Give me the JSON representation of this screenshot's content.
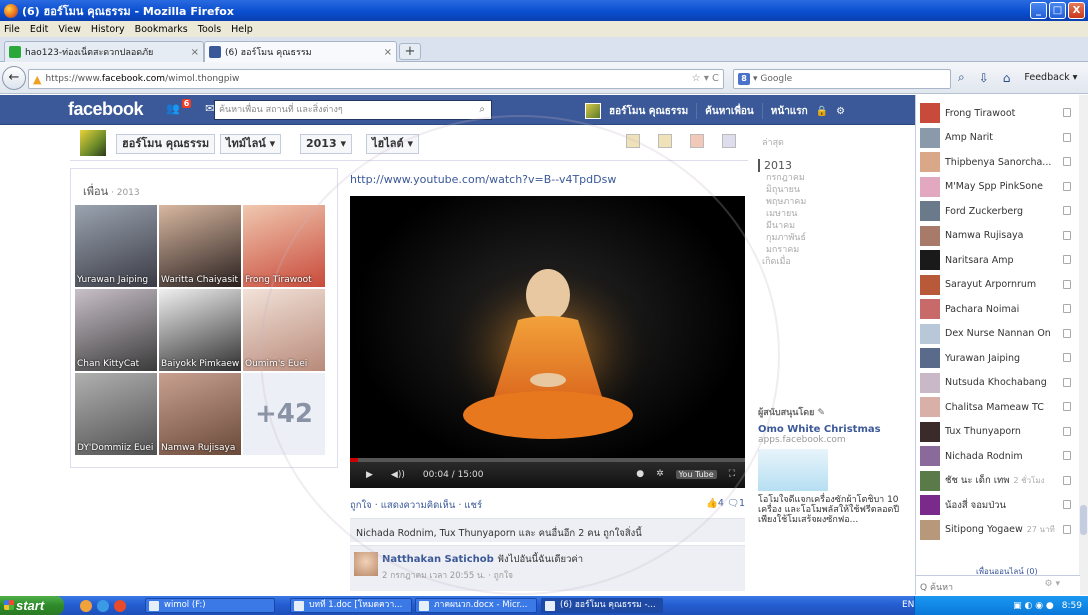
{
  "window": {
    "title": "(6) ฮอร์โมน คุณธรรม - Mozilla Firefox",
    "min": "_",
    "max": "□",
    "close": "X"
  },
  "menu": [
    "File",
    "Edit",
    "View",
    "History",
    "Bookmarks",
    "Tools",
    "Help"
  ],
  "tabs": [
    {
      "label": "hao123-ท่องเน็ตสะดวกปลอดภัย",
      "close": "×",
      "active": false
    },
    {
      "label": "(6) ฮอร์โมน คุณธรรม",
      "close": "×",
      "active": true
    }
  ],
  "newtab": "+",
  "nav": {
    "back": "←",
    "url_prefix": "https://www.",
    "url_domain": "facebook.com",
    "url_path": "/wimol.thongpiw",
    "url_right": "☆ ▾ C",
    "search_engine": "8",
    "search_placeholder": "▾ Google",
    "search_icon": "⌕",
    "download_icon": "⇩",
    "home_icon": "⌂",
    "feedback": "Feedback ▾"
  },
  "fb": {
    "logo": "facebook",
    "notif_badge": "6",
    "search_placeholder": "ค้นหาเพื่อน สถานที่ และสิ่งต่างๆ",
    "search_icon": "⌕",
    "user": "ฮอร์โมน คุณธรรม",
    "find_friends": "ค้นหาเพื่อน",
    "home": "หน้าแรก",
    "menu_icon": "⚙"
  },
  "profile": {
    "name": "ฮอร์โมน คุณธรรม",
    "timeline": "ไทม์ไลน์ ▾",
    "year": "2013 ▾",
    "highlights": "ไฮไลต์ ▾"
  },
  "friends": {
    "title": "เพื่อน",
    "year": " · 2013",
    "more": "+42",
    "list": [
      {
        "name": "Yurawan Jaiping",
        "color1": "#9aa4b0",
        "color2": "#3a3a44"
      },
      {
        "name": "Waritta Chaiyasit",
        "color1": "#d8b8a0",
        "color2": "#2a2020"
      },
      {
        "name": "Frong Tirawoot",
        "color1": "#f0c8b0",
        "color2": "#c84a3a"
      },
      {
        "name": "Chan KittyCat",
        "color1": "#c8c0c8",
        "color2": "#3a3a3a"
      },
      {
        "name": "Baiyokk Pimkaew",
        "color1": "#f0f0f0",
        "color2": "#303030"
      },
      {
        "name": "Oumim's Euei",
        "color1": "#f2e2d8",
        "color2": "#b88a7a"
      },
      {
        "name": "DY'Dommiiz Euei",
        "color1": "#b0b0b0",
        "color2": "#505050"
      },
      {
        "name": "Namwa Rujisaya",
        "color1": "#c8a090",
        "color2": "#6a4a3a"
      }
    ]
  },
  "post": {
    "link": "http://www.youtube.com/watch?v=B--v4TpdDsw",
    "time": "00:04 / 15:00",
    "progress": 0.02,
    "play": "▶",
    "volume": "◀))",
    "yt": "You Tube",
    "actions": "ถูกใจ · แสดงความคิดเห็น · แชร์",
    "counts": "👍4 🗨1",
    "likers": "Nichada Rodnim, Tux Thunyaporn และ คนอื่นอีก 2 คน ถูกใจสิ่งนี้",
    "comment_name": "Natthakan Satichob",
    "comment_text": "ฟังไปอันนี้ฉันเดียวค่า",
    "comment_meta": "2 กรกฎาคม เวลา 20:55 น. · ถูกใจ"
  },
  "timeline": {
    "recent": "ล่าสุด",
    "year": "2013",
    "months": [
      "กรกฎาคม",
      "มิถุนายน",
      "พฤษภาคม",
      "เมษายน",
      "มีนาคม",
      "กุมภาพันธ์",
      "มกราคม"
    ],
    "born": "เกิดเมื่อ"
  },
  "sponsored": {
    "title": "ผู้สนับสนุนโดย ✎",
    "name": "Omo White Christmas",
    "domain": "apps.facebook.com",
    "text": "โอโมใจดีแจกเครื่องซักผ้าโตชิบา 10 เครื่อง และโอโมพลัสให้ใช้ฟรีตลอดปี เพียงใช้โมเสร้จผงซักฟอ..."
  },
  "chat": {
    "items": [
      {
        "name": "Frong Tirawoot",
        "time": "",
        "color": "#c84a3a"
      },
      {
        "name": "Amp Narit",
        "time": "",
        "color": "#8a9aaa"
      },
      {
        "name": "Thipbenya Sanorcha...",
        "time": "",
        "color": "#d8a888"
      },
      {
        "name": "M'May Spp PinkSone",
        "time": "",
        "color": "#e2a8c0"
      },
      {
        "name": "Ford Zuckerberg",
        "time": "",
        "color": "#6a7a8a"
      },
      {
        "name": "Namwa Rujisaya",
        "time": "",
        "color": "#a87a6a"
      },
      {
        "name": "Naritsara Amp",
        "time": "",
        "color": "#1a1a1a"
      },
      {
        "name": "Sarayut Arpornrum",
        "time": "",
        "color": "#b85a3a"
      },
      {
        "name": "Pachara Noimai",
        "time": "",
        "color": "#c86a6a"
      },
      {
        "name": "Dex Nurse Nannan On",
        "time": "",
        "color": "#b8c8d8"
      },
      {
        "name": "Yurawan Jaiping",
        "time": "",
        "color": "#5a6a8a"
      },
      {
        "name": "Nutsuda Khochabang",
        "time": "",
        "color": "#c8b8c8"
      },
      {
        "name": "Chalitsa Mameaw TC",
        "time": "",
        "color": "#d8b0a8"
      },
      {
        "name": "Tux Thunyaporn",
        "time": "",
        "color": "#3a2a2a"
      },
      {
        "name": "Nichada Rodnim",
        "time": "",
        "color": "#8a6a9a"
      },
      {
        "name": "ชัช นะ เด็ก เทพ",
        "time": "2 ชั่วโมง",
        "color": "#5a7a4a"
      },
      {
        "name": "น้องสี่ จอมป่วน",
        "time": "",
        "color": "#7a2a8a"
      },
      {
        "name": "Sitipong Yogaew",
        "time": "27 นาที",
        "color": "#b8987a"
      }
    ],
    "search": "Q ค้นหา",
    "gear": "⚙ ▾",
    "footer": "เพื่อนออนไลน์ (0)"
  },
  "taskbar": {
    "start": "start",
    "buttons": [
      "wimol (F:)",
      "บทที่ 1.doc [โหมดควา...",
      "ภาคผนวก.docx - Micr...",
      "(6) ฮอร์โมน คุณธรรม -..."
    ],
    "lang": "EN",
    "clock": "8:59"
  }
}
